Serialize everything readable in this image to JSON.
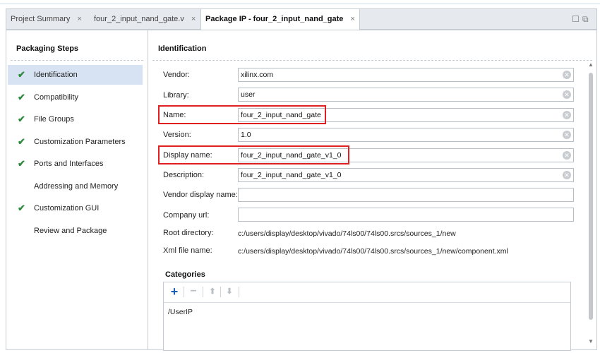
{
  "tabs": [
    {
      "label": "Project Summary",
      "close": "×"
    },
    {
      "label": "four_2_input_nand_gate.v",
      "close": "×"
    },
    {
      "label": "Package IP - four_2_input_nand_gate",
      "close": "×",
      "active": true
    }
  ],
  "window_controls": {
    "restore": "☐",
    "maximize": "⧉"
  },
  "sidebar": {
    "title": "Packaging Steps",
    "check_glyph": "✔",
    "steps": [
      {
        "label": "Identification",
        "done": true,
        "selected": true
      },
      {
        "label": "Compatibility",
        "done": true
      },
      {
        "label": "File Groups",
        "done": true
      },
      {
        "label": "Customization Parameters",
        "done": true
      },
      {
        "label": "Ports and Interfaces",
        "done": true
      },
      {
        "label": "Addressing and Memory",
        "done": false
      },
      {
        "label": "Customization GUI",
        "done": true
      },
      {
        "label": "Review and Package",
        "done": false
      }
    ]
  },
  "identification": {
    "title": "Identification",
    "clear_glyph": "✕",
    "fields": [
      {
        "label": "Vendor:",
        "value": "xilinx.com"
      },
      {
        "label": "Library:",
        "value": "user"
      },
      {
        "label": "Name:",
        "value": "four_2_input_nand_gate",
        "highlighted": true
      },
      {
        "label": "Version:",
        "value": "1.0"
      },
      {
        "label": "Display name:",
        "value": "four_2_input_nand_gate_v1_0",
        "highlighted": true
      },
      {
        "label": "Description:",
        "value": "four_2_input_nand_gate_v1_0"
      },
      {
        "label": "Vendor display name:",
        "value": ""
      },
      {
        "label": "Company url:",
        "value": ""
      }
    ],
    "root_directory": {
      "label": "Root directory:",
      "value": "c:/users/display/desktop/vivado/74ls00/74ls00.srcs/sources_1/new"
    },
    "xml_file_name": {
      "label": "Xml file name:",
      "value": "c:/users/display/desktop/vivado/74ls00/74ls00.srcs/sources_1/new/component.xml"
    }
  },
  "categories": {
    "title": "Categories",
    "toolbar": {
      "add": "+",
      "remove": "−",
      "up": "⬆",
      "down": "⬇"
    },
    "items": [
      "/UserIP"
    ]
  },
  "scrollbar": {
    "up": "▲",
    "down": "▼"
  },
  "colors": {
    "accent": "#1a5fb4",
    "highlight_box": "#e02020",
    "check": "#2e8b3e",
    "selected_row": "#d7e3f3"
  }
}
